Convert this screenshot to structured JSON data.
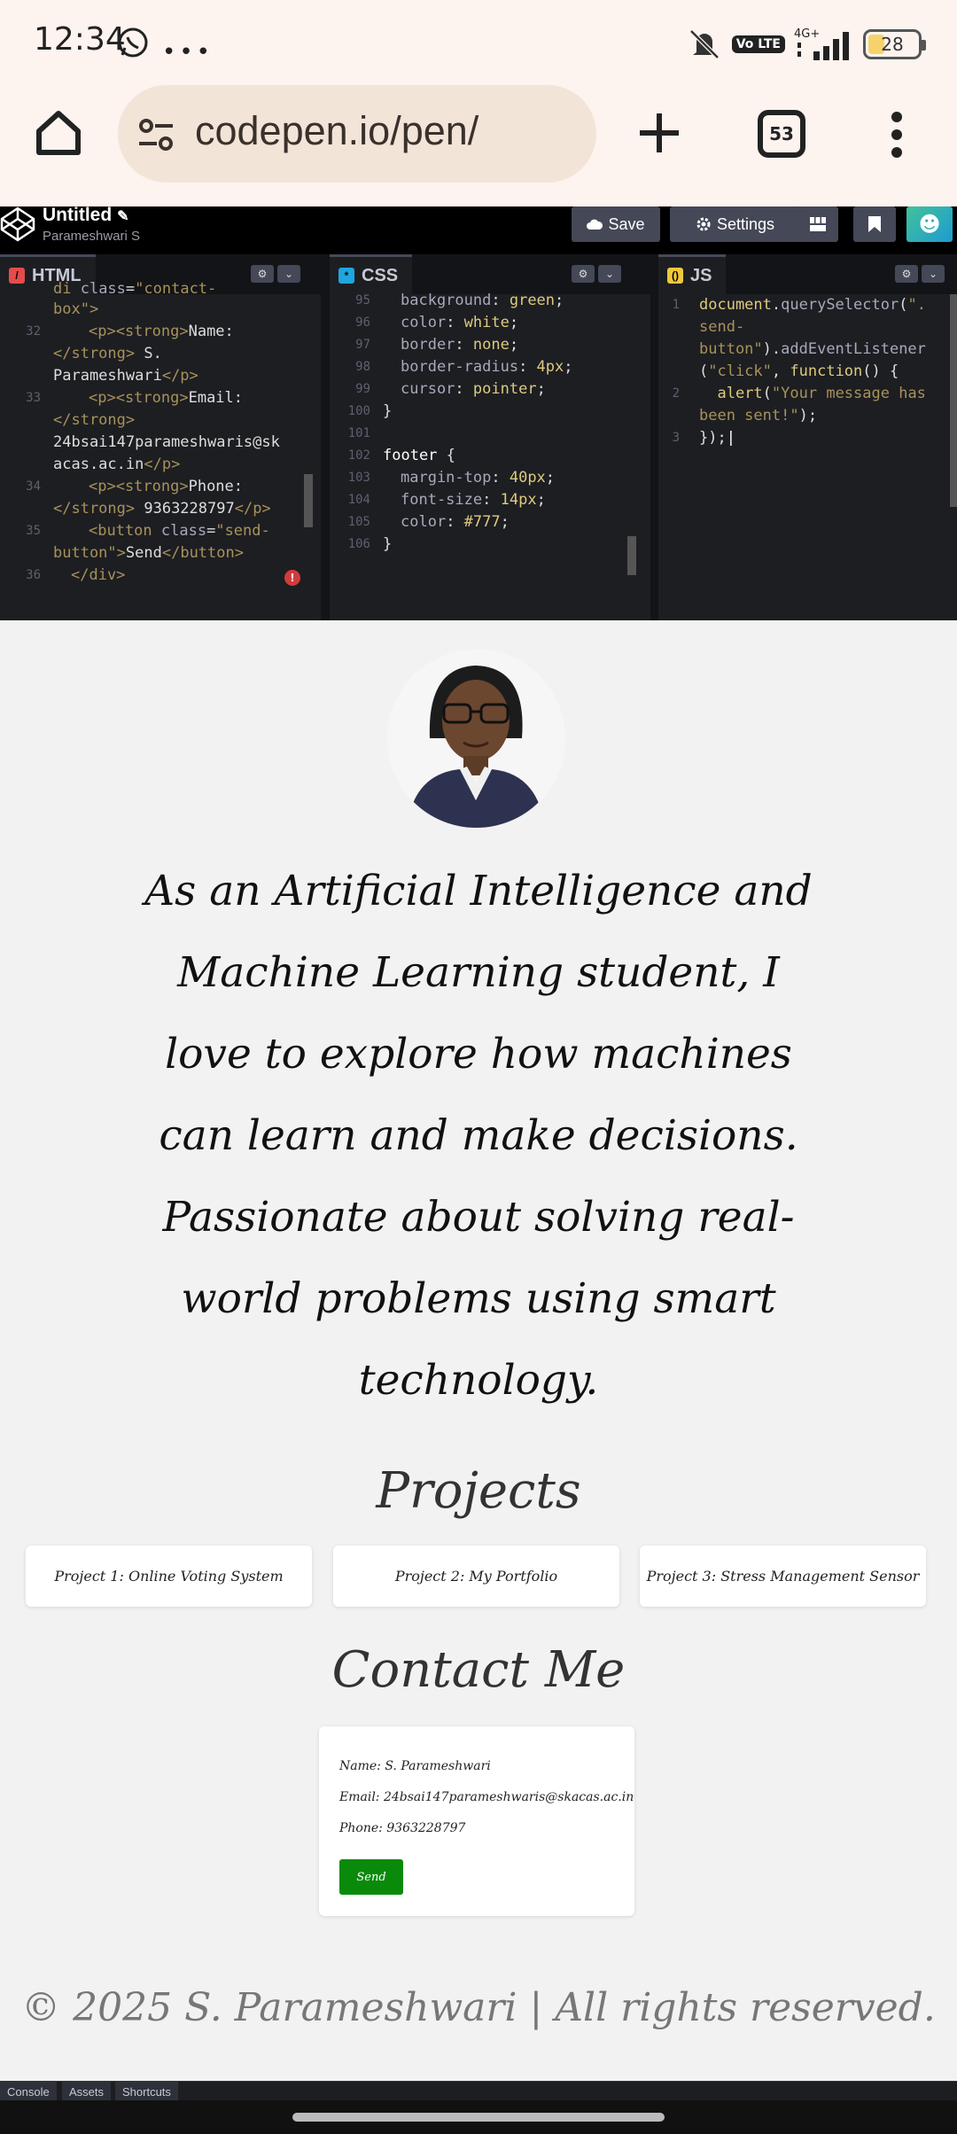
{
  "status_bar": {
    "time": "12:34",
    "volte": "Vo LTE",
    "network": "4G+",
    "battery": "28"
  },
  "browser": {
    "url": "codepen.io/pen/",
    "tab_count": "53"
  },
  "codepen": {
    "title": "Untitled",
    "author": "Parameshwari S",
    "save_label": "Save",
    "settings_label": "Settings"
  },
  "editors": {
    "html": {
      "tab": "HTML",
      "line_numbers": [
        "32",
        "33",
        "34",
        "35",
        "36"
      ],
      "lines": [
        "    <div class=\"contact-",
        "    box\">",
        "      <p><strong>Name:",
        "    </strong> S.",
        "    Parameshwari</p>",
        "      <p><strong>Email:",
        "    </strong>",
        "    24bsai147parameshwaris@sk",
        "    acas.ac.in</p>",
        "      <p><strong>Phone:",
        "    </strong> 9363228797</p>",
        "      <button class=\"send-",
        "    button\">Send</button>",
        "  </div>"
      ]
    },
    "css": {
      "tab": "CSS",
      "line_numbers": [
        "95",
        "96",
        "97",
        "98",
        "99",
        "100",
        "101",
        "102",
        "103",
        "104",
        "105",
        "106"
      ],
      "lines": [
        "  background: green;",
        "  color: white;",
        "  border: none;",
        "  border-radius: 4px;",
        "  cursor: pointer;",
        "}",
        "",
        "footer {",
        "  margin-top: 40px;",
        "  font-size: 14px;",
        "  color: #777;",
        "}"
      ]
    },
    "js": {
      "tab": "JS",
      "line_numbers": [
        "1",
        "2",
        "3"
      ],
      "lines": [
        "document.querySelector(\".",
        "send-",
        "button\").addEventListener",
        "(\"click\", function() {",
        "  alert(\"Your message has",
        "been sent!\");",
        "});"
      ]
    }
  },
  "preview": {
    "bio": "As an Artificial Intelligence and Machine Learning student, I love to explore how machines can learn and make decisions. Passionate about solving real-world problems using smart technology.",
    "projects_heading": "Projects",
    "projects": [
      "Project 1: Online Voting System",
      "Project 2: My Portfolio",
      "Project 3: Stress Management Sensor"
    ],
    "contact_heading": "Contact Me",
    "contact": {
      "name_label": "Name:",
      "name": "S. Parameshwari",
      "email_label": "Email:",
      "email": "24bsai147parameshwaris@skacas.ac.in",
      "phone_label": "Phone:",
      "phone": "9363228797",
      "send_label": "Send"
    },
    "footer": "© 2025 S. Parameshwari | All rights reserved."
  },
  "bottom_bar": {
    "console": "Console",
    "assets": "Assets",
    "shortcuts": "Shortcuts"
  },
  "colors": {
    "codepen_bg": "#131417",
    "editor_bg": "#1d1e22",
    "send_button": "#0a8a0a",
    "preview_bg": "#f2f2f2"
  },
  "icons": [
    "whatsapp-icon",
    "mute-icon",
    "signal-icon",
    "home-icon",
    "site-settings-icon",
    "plus-icon",
    "tabs-icon",
    "menu-icon",
    "codepen-logo-icon",
    "cloud-icon",
    "gear-icon",
    "layout-icon",
    "pin-icon"
  ]
}
